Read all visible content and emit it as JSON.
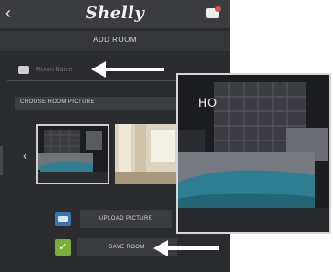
{
  "topbar": {
    "brand": "Shelly",
    "back_icon": "chevron-left-icon",
    "notification_icon": "notification-icon"
  },
  "header": {
    "title": "ADD ROOM"
  },
  "room_name": {
    "value": "",
    "placeholder": "Room Name",
    "icon": "room-icon"
  },
  "picture_section": {
    "label": "CHOOSE ROOM PICTURE",
    "prev_icon": "chevron-left-icon"
  },
  "upload": {
    "label": "UPLOAD PICTURE",
    "icon": "image-icon"
  },
  "save": {
    "label": "SAVE ROOM",
    "icon": "checkmark-icon"
  },
  "zoom_preview": {
    "label": "HO"
  },
  "colors": {
    "app_background": "#2a2c2f",
    "bar": "#3a3c40",
    "accent_blue": "#3d74a8",
    "accent_green": "#7bb038",
    "pointer": "#ffffff"
  }
}
